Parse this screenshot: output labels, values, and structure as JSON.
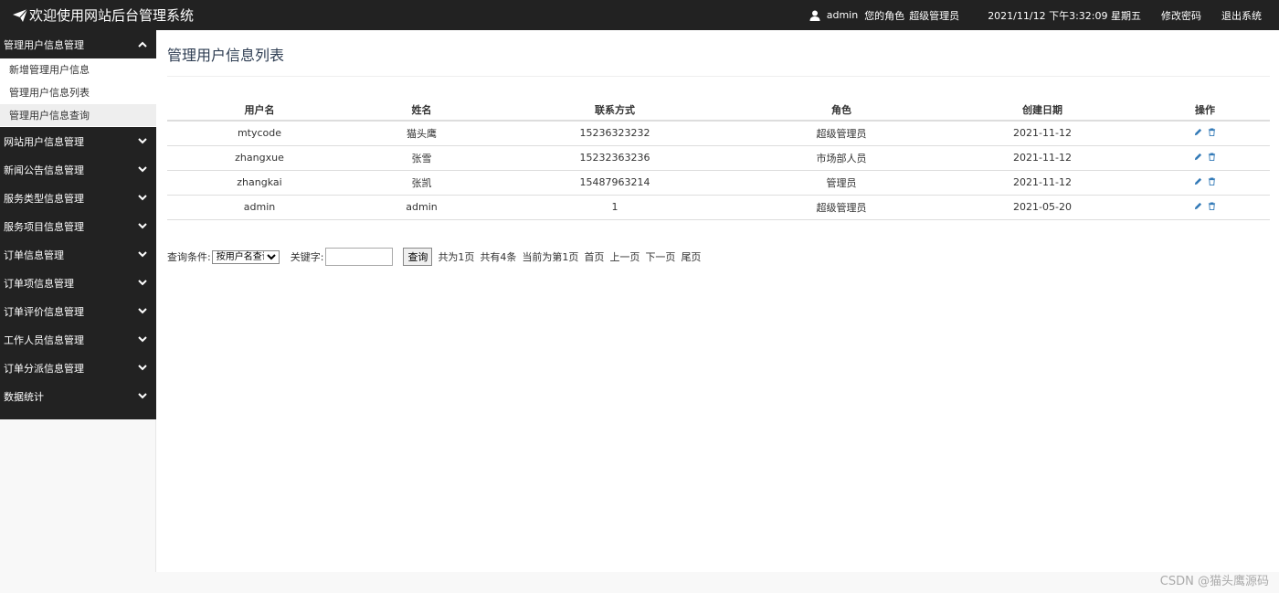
{
  "header": {
    "title": "欢迎使用网站后台管理系统",
    "username": "admin",
    "role_label": "您的角色",
    "role_value": "超级管理员",
    "datetime": "2021/11/12 下午3:32:09 星期五",
    "change_password": "修改密码",
    "logout": "退出系统"
  },
  "sidebar": {
    "expanded_group": {
      "label": "管理用户信息管理",
      "items": [
        {
          "label": "新增管理用户信息"
        },
        {
          "label": "管理用户信息列表"
        },
        {
          "label": "管理用户信息查询"
        }
      ]
    },
    "groups": [
      {
        "label": "网站用户信息管理"
      },
      {
        "label": "新闻公告信息管理"
      },
      {
        "label": "服务类型信息管理"
      },
      {
        "label": "服务项目信息管理"
      },
      {
        "label": "订单信息管理"
      },
      {
        "label": "订单项信息管理"
      },
      {
        "label": "订单评价信息管理"
      },
      {
        "label": "工作人员信息管理"
      },
      {
        "label": "订单分派信息管理"
      },
      {
        "label": "数据统计"
      }
    ]
  },
  "main": {
    "title": "管理用户信息列表",
    "table": {
      "columns": [
        "用户名",
        "姓名",
        "联系方式",
        "角色",
        "创建日期",
        "操作"
      ],
      "rows": [
        {
          "username": "mtycode",
          "name": "猫头鹰",
          "phone": "15236323232",
          "role": "超级管理员",
          "created": "2021-11-12"
        },
        {
          "username": "zhangxue",
          "name": "张雪",
          "phone": "15232363236",
          "role": "市场部人员",
          "created": "2021-11-12"
        },
        {
          "username": "zhangkai",
          "name": "张凯",
          "phone": "15487963214",
          "role": "管理员",
          "created": "2021-11-12"
        },
        {
          "username": "admin",
          "name": "admin",
          "phone": "1",
          "role": "超级管理员",
          "created": "2021-05-20"
        }
      ]
    },
    "search": {
      "condition_label": "查询条件:",
      "condition_value": "按用户名查询",
      "keyword_label": "关键字:",
      "keyword_value": "",
      "button": "查询",
      "total_pages": "共为1页",
      "total_items": "共有4条",
      "current_page": "当前为第1页",
      "first": "首页",
      "prev": "上一页",
      "next": "下一页",
      "last": "尾页"
    }
  },
  "watermark": "CSDN @猫头鹰源码",
  "colors": {
    "topbar": "#222222",
    "sidebar": "#222222",
    "icon_blue": "#337ab7",
    "title": "#2e3d52"
  }
}
